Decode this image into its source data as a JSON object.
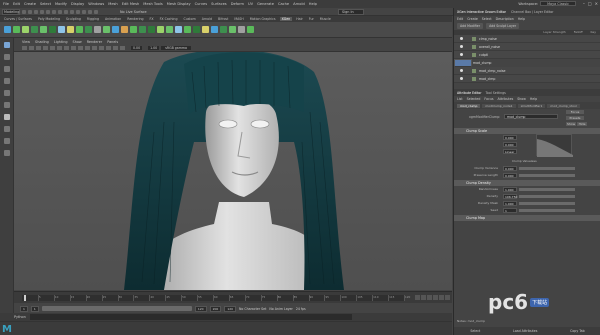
{
  "menubar": {
    "items": [
      "File",
      "Edit",
      "Create",
      "Select",
      "Modify",
      "Display",
      "Windows",
      "Mesh",
      "Edit Mesh",
      "Mesh Tools",
      "Mesh Display",
      "Curves",
      "Surfaces",
      "Deform",
      "UV",
      "Generate",
      "Cache",
      "Arnold",
      "Help"
    ],
    "workspace_label": "Workspace:",
    "workspace_value": "Maya Classic"
  },
  "status": {
    "mode": "Modeling",
    "live": "No Live Surface",
    "signin": "Sign In"
  },
  "shelf": {
    "tabs": [
      "Curves / Surfaces",
      "Poly Modeling",
      "Sculpting",
      "Rigging",
      "Animation",
      "Rendering",
      "FX",
      "FX Caching",
      "Custom",
      "Arnold",
      "Bifrost",
      "MASH",
      "Motion Graphics",
      "XGen",
      "Hair",
      "Fur",
      "Muscle"
    ],
    "active": "XGen",
    "icon_colors": [
      "#4aa0d8",
      "#5aba5a",
      "#9bd36a",
      "#3d8f4e",
      "#6ac06a",
      "#2f7a3a",
      "#8ec4e8",
      "#d8d06a",
      "#5aba5a",
      "#3d8f4e",
      "#a0a0a0",
      "#6ac06a",
      "#4aa0d8",
      "#d8a050",
      "#5aba5a",
      "#3d8f4e",
      "#2f7a3a",
      "#9bd36a",
      "#6ac06a",
      "#8ec4e8",
      "#5aba5a",
      "#2f7a3a",
      "#d8d06a",
      "#4aa0d8",
      "#3d8f4e",
      "#6ac06a",
      "#a0a0a0",
      "#5aba5a"
    ]
  },
  "viewport": {
    "menu": [
      "View",
      "Shading",
      "Lighting",
      "Show",
      "Renderer",
      "Panels"
    ],
    "num_a": "0.00",
    "num_b": "1.00",
    "colorspace": "sRGB gamma",
    "hair_color": "#123a40",
    "skin_color": "#d6d6d6"
  },
  "timeline": {
    "ticks": [
      "5",
      "10",
      "15",
      "20",
      "25",
      "30",
      "35",
      "40",
      "45",
      "50",
      "55",
      "60",
      "65",
      "70",
      "75",
      "80",
      "85",
      "90",
      "95",
      "100",
      "105",
      "110",
      "115",
      "120"
    ],
    "start": "1",
    "start2": "1",
    "end": "120",
    "end2": "200",
    "cur": "120",
    "character": "No Character Set",
    "anim_layer": "No Anim Layer",
    "fps": "24 fps"
  },
  "command": {
    "lang": "Python"
  },
  "layers": {
    "title_tabs": [
      "XGen Interactive Groom Editor",
      "Channel Box / Layer Editor"
    ],
    "menu": [
      "Edit",
      "Create",
      "Select",
      "Description",
      "Help"
    ],
    "buttons": [
      "Add Modifier",
      "Add Sculpt Layer"
    ],
    "header": [
      "Layer Strength",
      "Falloff",
      "Key"
    ],
    "rows": [
      "clmp_noise",
      "overall_noise",
      "cutptl",
      "mod_clump",
      "mod_clmp_noise",
      "mod_clmp"
    ]
  },
  "attributes": {
    "tabs": [
      "Attribute Editor",
      "Tool Settings"
    ],
    "menu": [
      "List",
      "Selected",
      "Focus",
      "Attributes",
      "Show",
      "Help"
    ],
    "node_tabs": [
      "mod_clump",
      "modClump_node1",
      "xiCutModifier1",
      "mod_clump_xtool"
    ],
    "node_label": "xgmModifierClump:",
    "node_value": "mod_clump",
    "focus_btn": "Focus",
    "presets_btn": "Presets",
    "show_btn": "Show",
    "hide_btn": "Hide",
    "sections": [
      "Clump Scale",
      "Clump Density",
      "Clump Map"
    ],
    "rows1": [
      {
        "l": "Selected Position",
        "v": "0.000"
      },
      {
        "l": "Selected Value",
        "v": "0.000"
      },
      {
        "l": "Interpolation",
        "v": "Linear"
      }
    ],
    "clump_valueless": "Clump Valueless",
    "rows2": [
      {
        "l": "Clump Variance",
        "v": "0.000"
      },
      {
        "l": "Preserve Length",
        "v": "0.000"
      }
    ],
    "rows3": [
      {
        "l": "Randomness",
        "v": "1.000"
      },
      {
        "l": "Density",
        "v": "106.750"
      },
      {
        "l": "Density Mask",
        "v": "1.000"
      },
      {
        "l": "Seed",
        "v": "1"
      }
    ],
    "notes": "Notes: mod_clump",
    "bottom": [
      "Select",
      "Load Attributes",
      "Copy Tab"
    ]
  },
  "watermark": {
    "text": "pc6",
    "sub": "下载站"
  }
}
